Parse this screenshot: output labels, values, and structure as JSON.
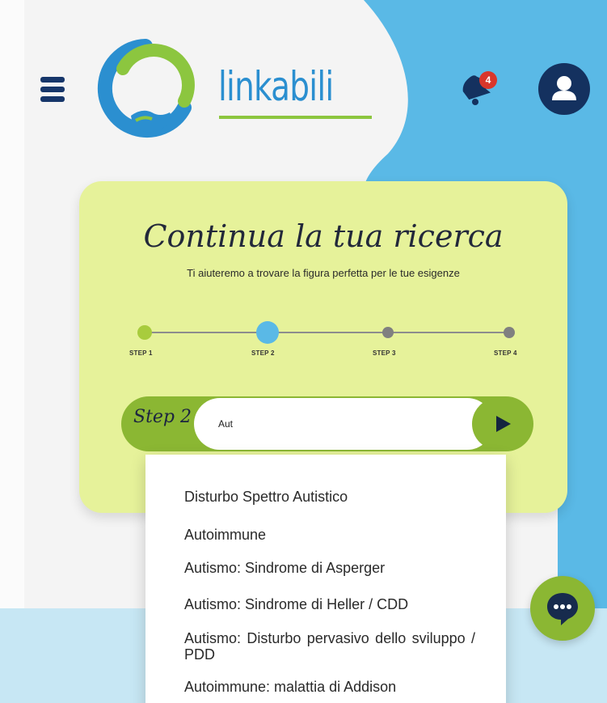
{
  "header": {
    "logo_text": "linkabili",
    "notification_count": "4"
  },
  "card": {
    "title": "Continua la tua ricerca",
    "subtitle": "Ti aiuteremo a trovare la figura perfetta per le tue esigenze",
    "steps": [
      {
        "label": "STEP 1",
        "state": "done"
      },
      {
        "label": "STEP 2",
        "state": "current"
      },
      {
        "label": "STEP 3",
        "state": "pending"
      },
      {
        "label": "STEP 4",
        "state": "pending"
      }
    ],
    "step_tag": "Step 2",
    "search_value": "Aut"
  },
  "suggestions": [
    "Disturbo Spettro Autistico",
    "Autoimmune",
    "Autismo: Sindrome di Asperger",
    "Autismo: Sindrome di Heller / CDD",
    "Autismo: Disturbo pervasivo dello sviluppo / PDD",
    "Autoimmune: malattia di Addison"
  ],
  "colors": {
    "brand_blue": "#2b8fd0",
    "brand_green": "#8cc63f",
    "navy": "#14315f",
    "card_bg": "#e6f29a",
    "sky": "#5ab9e6",
    "alert_red": "#d9362b"
  },
  "icons": {
    "menu": "hamburger-menu-icon",
    "bell": "bell-icon",
    "user": "user-icon",
    "play": "play-icon",
    "chat": "chat-bubble-icon"
  }
}
